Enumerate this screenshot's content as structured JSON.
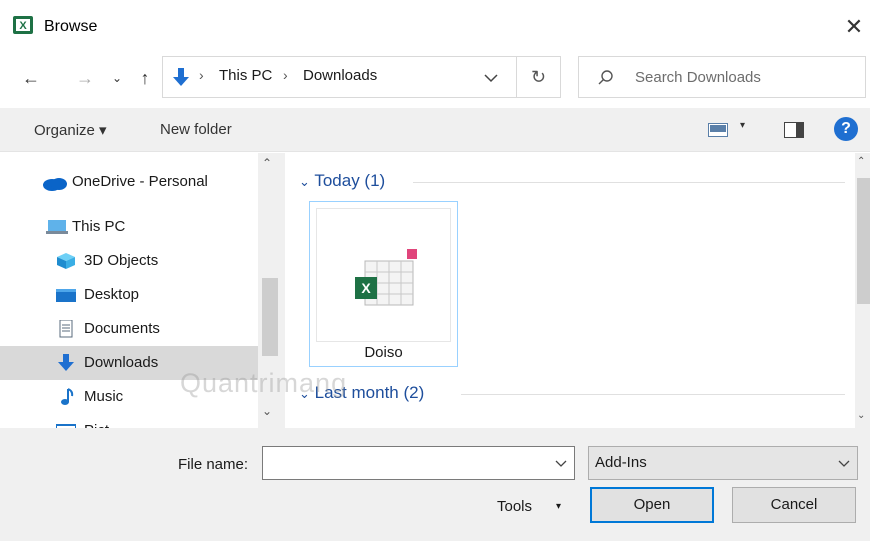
{
  "window": {
    "title": "Browse",
    "close_glyph": "✕"
  },
  "nav": {
    "back_glyph": "←",
    "forward_glyph": "→",
    "recent_glyph": "⌄",
    "up_glyph": "↑",
    "breadcrumb": [
      "This PC",
      "Downloads"
    ],
    "breadcrumb_sep": "›",
    "refresh_glyph": "↻",
    "search_placeholder": "Search Downloads"
  },
  "toolbar": {
    "organize": "Organize ▾",
    "new_folder": "New folder",
    "view_caret": "▾",
    "help": "?"
  },
  "sidebar": {
    "items": [
      {
        "label": "OneDrive - Personal",
        "icon": "onedrive-cloud-icon"
      },
      {
        "label": "This PC",
        "icon": "this-pc-icon"
      },
      {
        "label": "3D Objects",
        "icon": "3d-objects-icon"
      },
      {
        "label": "Desktop",
        "icon": "desktop-icon"
      },
      {
        "label": "Documents",
        "icon": "documents-icon"
      },
      {
        "label": "Downloads",
        "icon": "downloads-icon",
        "selected": true
      },
      {
        "label": "Music",
        "icon": "music-icon"
      },
      {
        "label": "Pict",
        "icon": "pictures-icon"
      }
    ],
    "scroll_up": "⌃",
    "scroll_down": "⌄"
  },
  "content": {
    "groups": [
      {
        "label": "Today (1)",
        "files": [
          {
            "name": "Doiso",
            "icon": "excel-addin-file-icon"
          }
        ]
      },
      {
        "label": "Last month (2)",
        "files": []
      }
    ]
  },
  "footer": {
    "file_name_label": "File name:",
    "file_name_value": "",
    "filter_value": "Add-Ins",
    "tools": "Tools",
    "tools_caret": "▾",
    "open": "Open",
    "cancel": "Cancel"
  },
  "watermark": "Quantrimang",
  "colors": {
    "accent": "#0078d7",
    "group_header": "#1e4e9c",
    "selected_row": "#d9d9d9",
    "help_blue": "#1f6fd1",
    "excel_green": "#1e7145"
  }
}
